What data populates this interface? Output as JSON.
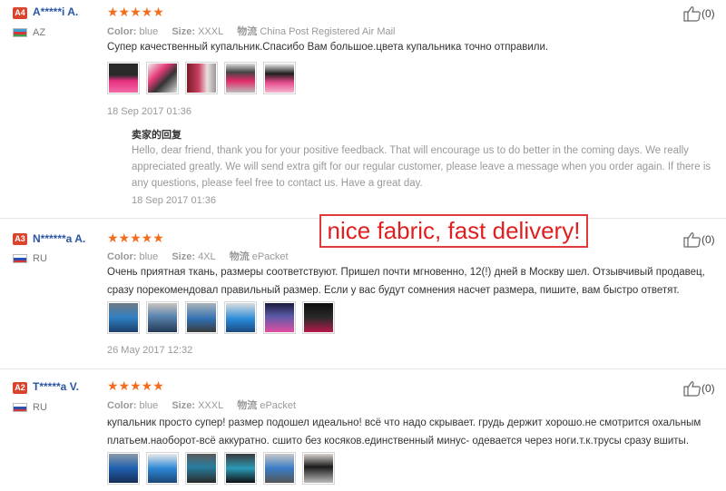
{
  "reviews": [
    {
      "level": "A4",
      "level_color": "#d9442c",
      "name": "A*****i A.",
      "country": "AZ",
      "stars": "★★★★★",
      "color_label": "Color:",
      "color_value": "blue",
      "size_label": "Size:",
      "size_value": "XXXL",
      "ship_label": "物流",
      "ship_value": "China Post Registered Air Mail",
      "text": "Супер качественный купальник.Спасибо Вам большое.цвета купальника точно отправили.",
      "date": "18 Sep 2017 01:36",
      "helpful": "(0)",
      "reply": {
        "title": "卖家的回复",
        "text": "Hello, dear friend, thank you for your positive feedback. That will encourage us to do better in the coming days. We really appreciated greatly. We will send extra gift for our regular customer, please leave a message when you order again. If there is any questions, please feel free to contact us. Have a great day.",
        "date": "18 Sep 2017 01:36"
      }
    },
    {
      "level": "A3",
      "level_color": "#d9442c",
      "name": "N******a A.",
      "country": "RU",
      "stars": "★★★★★",
      "color_label": "Color:",
      "color_value": "blue",
      "size_label": "Size:",
      "size_value": "4XL",
      "ship_label": "物流",
      "ship_value": "ePacket",
      "text": "Очень приятная ткань, размеры соответствуют. Пришел почти мгновенно, 12(!) дней в Москву шел. Отзывчивый продавец, сразу порекомендовал правильный размер. Если у вас будут сомнения насчет размера, пишите, вам быстро ответят.",
      "date": "26 May 2017 12:32",
      "helpful": "(0)"
    },
    {
      "level": "A2",
      "level_color": "#d9442c",
      "name": "T*****a V.",
      "country": "RU",
      "stars": "★★★★★",
      "color_label": "Color:",
      "color_value": "blue",
      "size_label": "Size:",
      "size_value": "XXXL",
      "ship_label": "物流",
      "ship_value": "ePacket",
      "text": "купальник просто супер! размер подошел идеально! всё что надо скрывает. грудь держит хорошо.не смотрится охальным платьем.наоборот-всё аккуратно. сшито без косяков.единственный минус- одевается через ноги.т.к.трусы сразу вшиты.",
      "helpful": "(0)"
    }
  ],
  "overlay_text": "nice fabric, fast delivery!"
}
